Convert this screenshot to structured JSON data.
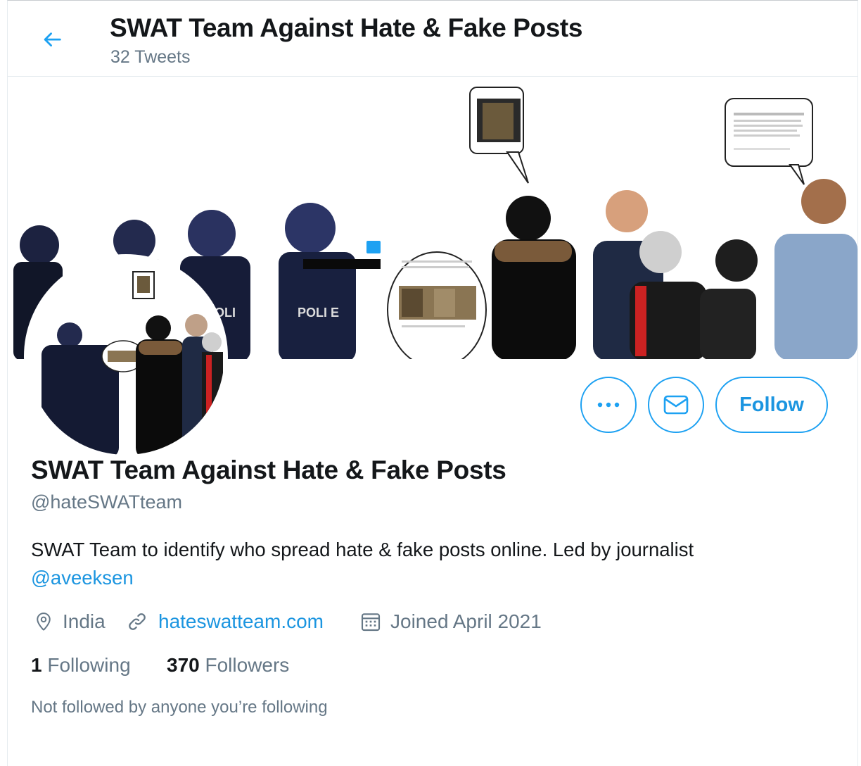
{
  "header": {
    "title": "SWAT Team Against Hate & Fake Posts",
    "tweet_count": "32 Tweets",
    "back_icon": "arrow-left-icon"
  },
  "colors": {
    "accent": "#1da1f2",
    "link": "#1b95e0",
    "secondary_text": "#657786",
    "primary_text": "#14171a"
  },
  "actions": {
    "more_icon": "ellipsis-icon",
    "message_icon": "envelope-icon",
    "follow_label": "Follow"
  },
  "profile": {
    "name": "SWAT Team Against Hate & Fake Posts",
    "handle": "@hateSWATteam",
    "bio_text": "SWAT Team to identify who spread hate & fake posts online. Led by journalist",
    "bio_mention": "@aveeksen",
    "location": "India",
    "website": "hateswatteam.com",
    "joined": "Joined April 2021",
    "following_count": "1",
    "following_label": "Following",
    "followers_count": "370",
    "followers_label": "Followers",
    "not_followed_text": "Not followed by anyone you’re following"
  }
}
